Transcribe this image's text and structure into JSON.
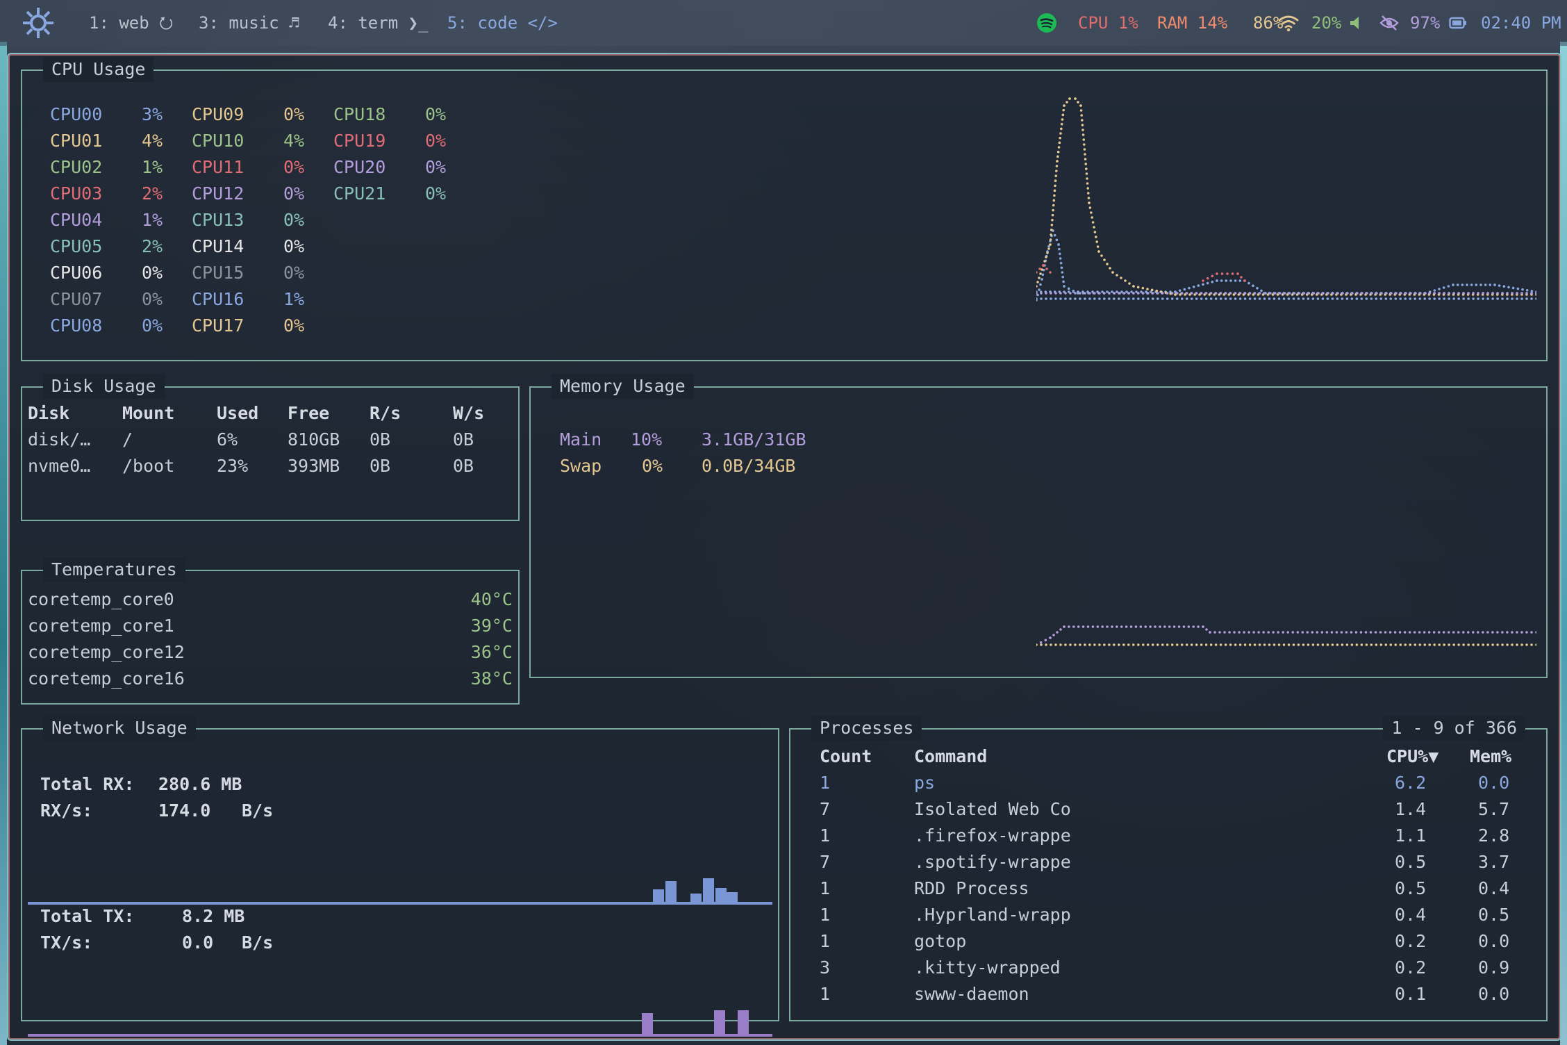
{
  "topbar": {
    "workspaces": [
      {
        "label": "1: web",
        "icon": "firefox-icon",
        "glyph": "⭮"
      },
      {
        "label": "3: music",
        "icon": "music-note-icon",
        "glyph": "♬"
      },
      {
        "label": "4: term",
        "icon": "terminal-icon",
        "glyph": "❯_"
      },
      {
        "label": "5: code",
        "icon": "code-icon",
        "glyph": "</>"
      }
    ],
    "cpu": "CPU 1%",
    "ram": "RAM 14%",
    "wifi": "86%",
    "volume": "20%",
    "idle": "97%",
    "battery_icon": "battery-icon",
    "clock": "02:40 PM"
  },
  "cpu_panel": {
    "title": "CPU Usage",
    "cores": [
      {
        "name": "CPU00",
        "value": "3%",
        "color": "#8aa8e0"
      },
      {
        "name": "CPU01",
        "value": "4%",
        "color": "#e5c890"
      },
      {
        "name": "CPU02",
        "value": "1%",
        "color": "#9cc48a"
      },
      {
        "name": "CPU03",
        "value": "2%",
        "color": "#e06c75"
      },
      {
        "name": "CPU04",
        "value": "1%",
        "color": "#b39ddb"
      },
      {
        "name": "CPU05",
        "value": "2%",
        "color": "#88c0b8"
      },
      {
        "name": "CPU06",
        "value": "0%",
        "color": "#e6e6e6"
      },
      {
        "name": "CPU07",
        "value": "0%",
        "color": "#8a929e"
      },
      {
        "name": "CPU08",
        "value": "0%",
        "color": "#8aa8e0"
      },
      {
        "name": "CPU09",
        "value": "0%",
        "color": "#e5c890"
      },
      {
        "name": "CPU10",
        "value": "4%",
        "color": "#9cc48a"
      },
      {
        "name": "CPU11",
        "value": "0%",
        "color": "#e06c75"
      },
      {
        "name": "CPU12",
        "value": "0%",
        "color": "#b39ddb"
      },
      {
        "name": "CPU13",
        "value": "0%",
        "color": "#88c0b8"
      },
      {
        "name": "CPU14",
        "value": "0%",
        "color": "#e6e6e6"
      },
      {
        "name": "CPU15",
        "value": "0%",
        "color": "#8a929e"
      },
      {
        "name": "CPU16",
        "value": "1%",
        "color": "#8aa8e0"
      },
      {
        "name": "CPU17",
        "value": "0%",
        "color": "#e5c890"
      },
      {
        "name": "CPU18",
        "value": "0%",
        "color": "#9cc48a"
      },
      {
        "name": "CPU19",
        "value": "0%",
        "color": "#e06c75"
      },
      {
        "name": "CPU20",
        "value": "0%",
        "color": "#b39ddb"
      },
      {
        "name": "CPU21",
        "value": "0%",
        "color": "#88c0b8"
      }
    ]
  },
  "disk_panel": {
    "title": "Disk Usage",
    "headers": [
      "Disk",
      "Mount",
      "Used",
      "Free",
      "R/s",
      "W/s"
    ],
    "rows": [
      [
        "disk/…",
        "/",
        "6%",
        "810GB",
        "0B",
        "0B"
      ],
      [
        "nvme0…",
        "/boot",
        "23%",
        "393MB",
        "0B",
        "0B"
      ]
    ]
  },
  "memory_panel": {
    "title": "Memory Usage",
    "main": {
      "label": "Main",
      "pct": "10%",
      "amount": "3.1GB/31GB"
    },
    "swap": {
      "label": "Swap",
      "pct": "0%",
      "amount": "0.0B/34GB"
    }
  },
  "temp_panel": {
    "title": "Temperatures",
    "rows": [
      {
        "sensor": "coretemp_core0",
        "temp": "40°C"
      },
      {
        "sensor": "coretemp_core1",
        "temp": "39°C"
      },
      {
        "sensor": "coretemp_core12",
        "temp": "36°C"
      },
      {
        "sensor": "coretemp_core16",
        "temp": "38°C"
      }
    ]
  },
  "network_panel": {
    "title": "Network Usage",
    "total_rx_label": "Total RX:",
    "total_rx": "280.6 MB",
    "rx_rate_label": "RX/s:",
    "rx_rate": "174.0",
    "rx_unit": "B/s",
    "total_tx_label": "Total TX:",
    "total_tx": "8.2 MB",
    "tx_rate_label": "TX/s:",
    "tx_rate": "0.0",
    "tx_unit": "B/s"
  },
  "process_panel": {
    "title": "Processes",
    "range": "1 - 9 of 366",
    "headers": {
      "count": "Count",
      "command": "Command",
      "cpu": "CPU%▼",
      "mem": "Mem%"
    },
    "rows": [
      {
        "count": "1",
        "command": "ps",
        "cpu": "6.2",
        "mem": "0.0"
      },
      {
        "count": "7",
        "command": "Isolated Web Co",
        "cpu": "1.4",
        "mem": "5.7"
      },
      {
        "count": "1",
        "command": ".firefox-wrappe",
        "cpu": "1.1",
        "mem": "2.8"
      },
      {
        "count": "7",
        "command": ".spotify-wrappe",
        "cpu": "0.5",
        "mem": "3.7"
      },
      {
        "count": "1",
        "command": "RDD Process",
        "cpu": "0.5",
        "mem": "0.4"
      },
      {
        "count": "1",
        "command": ".Hyprland-wrapp",
        "cpu": "0.4",
        "mem": "0.5"
      },
      {
        "count": "1",
        "command": "gotop",
        "cpu": "0.2",
        "mem": "0.0"
      },
      {
        "count": "3",
        "command": ".kitty-wrapped",
        "cpu": "0.2",
        "mem": "0.9"
      },
      {
        "count": "1",
        "command": "swww-daemon",
        "cpu": "0.1",
        "mem": "0.0"
      }
    ]
  },
  "colors": {
    "border": "#7da89e",
    "accent_red": "#e06c75",
    "accent_blue": "#8aa8e0",
    "accent_purple": "#b39ddb"
  }
}
